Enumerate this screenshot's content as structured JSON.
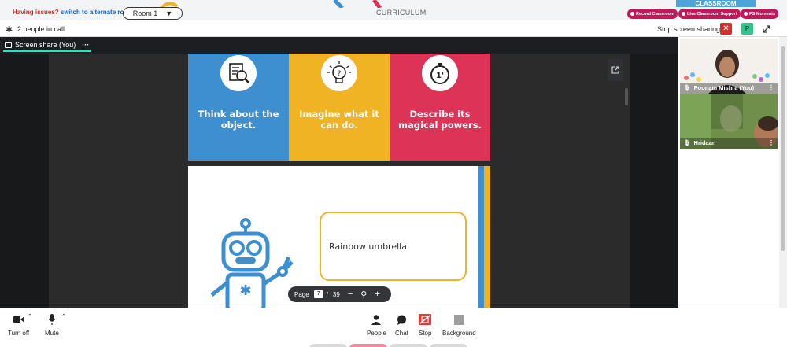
{
  "top": {
    "issues_text": "Having issues?",
    "issues_link": "switch to alternate room",
    "room_label": "Room 1",
    "room_caret": "▼",
    "curriculum_label": "CURRICULUM",
    "classroom_tag": "CLASSROOM",
    "pills": [
      "Record Classroom",
      "Live Classroom Support",
      "PS Moments"
    ]
  },
  "callbar": {
    "people_count": "2 people in call",
    "stop_sharing_label": "Stop screen sharing",
    "close_symbol": "✕",
    "avatar_letter": "P"
  },
  "stage": {
    "tab_label": "Screen share (You)",
    "tab_more": "···"
  },
  "slide": {
    "cards": [
      {
        "caption": "Think about the object.",
        "color": "#3d8fd0",
        "icon": "inspect-document-icon"
      },
      {
        "caption": "Imagine what it can do.",
        "color": "#f0b323",
        "icon": "idea-bulb-icon"
      },
      {
        "caption": "Describe its magical powers.",
        "color": "#dd3357",
        "icon": "stopwatch-icon",
        "timer_text": "1'"
      }
    ],
    "bubble_text": "Rainbow umbrella"
  },
  "pager": {
    "page_label": "Page",
    "current_page": "7",
    "separator": "/",
    "total_pages": "39",
    "zoom_out": "−",
    "zoom_icon": "⚲",
    "zoom_in": "+"
  },
  "participants": [
    {
      "name": "Poonam Mishra (You)",
      "more": "⋮"
    },
    {
      "name": "Hridaan",
      "more": "⋮"
    }
  ],
  "toolbar": {
    "turn_off": "Turn off",
    "mute": "Mute",
    "people": "People",
    "chat": "Chat",
    "stop": "Stop",
    "background": "Background"
  },
  "colors": {
    "accent_teal": "#1de9b6",
    "danger_red": "#d32f2f",
    "pill_magenta": "#c2185b",
    "card_blue": "#3d8fd0",
    "card_yellow": "#f0b323",
    "card_pink": "#dd3357"
  }
}
